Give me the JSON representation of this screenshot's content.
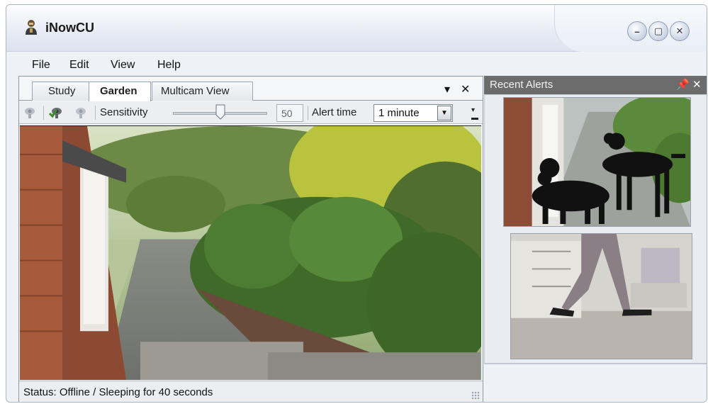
{
  "app": {
    "title": "iNowCU",
    "icon": "user-icon"
  },
  "window_controls": {
    "minimize": "minimize-icon",
    "restore": "restore-icon",
    "close": "close-icon"
  },
  "menu": [
    "File",
    "Edit",
    "View",
    "Help"
  ],
  "tabs": [
    {
      "label": "Study",
      "active": false
    },
    {
      "label": "Garden",
      "active": true
    },
    {
      "label": "Multicam View",
      "active": false
    }
  ],
  "tab_controls": {
    "dropdown": "▾",
    "close": "✕"
  },
  "toolbar": {
    "icons": [
      "camera-icon",
      "camera-enable-icon",
      "camera-disable-icon"
    ],
    "sensitivity_label": "Sensitivity",
    "sensitivity_value": "50",
    "sensitivity_fraction": 0.5,
    "alert_time_label": "Alert time",
    "alert_time_value": "1 minute"
  },
  "status": {
    "text": "Status:  Offline / Sleeping for 40 seconds"
  },
  "recent_alerts": {
    "title": "Recent Alerts",
    "pin": "pin-icon",
    "close": "close-icon",
    "thumbnails": [
      "alert-thumbnail-dogs",
      "alert-thumbnail-person"
    ]
  },
  "colors": {
    "panel_header": "#6c6c6c",
    "window_bg": "#eef1f6",
    "accent_green": "#3a8a2a"
  }
}
